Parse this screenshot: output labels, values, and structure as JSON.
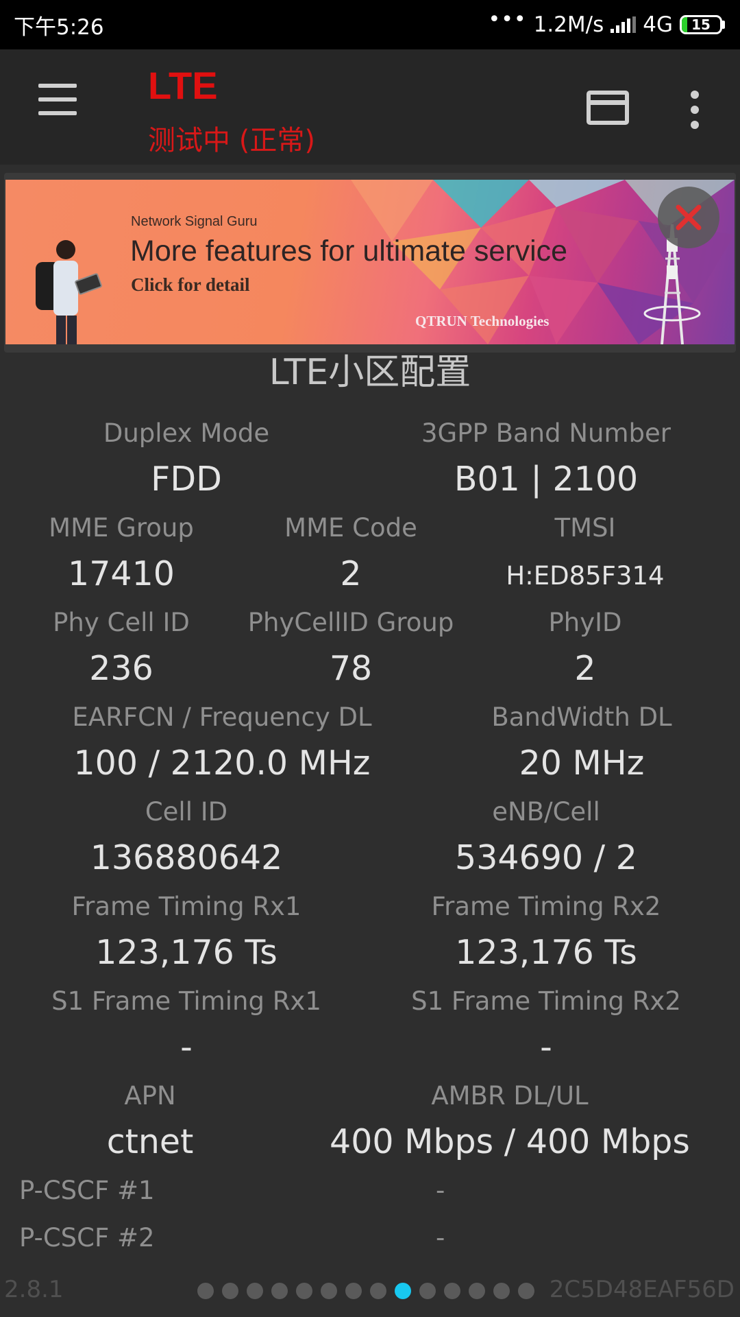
{
  "status_bar": {
    "time": "下午5:26",
    "dots": "•••",
    "speed": "1.2M/s",
    "network": "4G",
    "battery": "15",
    "battery_level": 0.15
  },
  "app_bar": {
    "title": "LTE",
    "subtitle": "测试中 (正常)"
  },
  "ad": {
    "brand": "Network Signal Guru",
    "headline": "More features for ultimate service",
    "subline": "Click for detail",
    "company": "QTRUN Technologies"
  },
  "section_title": "LTE小区配置",
  "fields": {
    "duplex_mode": {
      "label": "Duplex Mode",
      "value": "FDD"
    },
    "band_number": {
      "label": "3GPP Band Number",
      "value": "B01 | 2100"
    },
    "mme_group": {
      "label": "MME Group",
      "value": "17410"
    },
    "mme_code": {
      "label": "MME Code",
      "value": "2"
    },
    "tmsi": {
      "label": "TMSI",
      "value": "H:ED85F314"
    },
    "phy_cell_id": {
      "label": "Phy Cell ID",
      "value": "236"
    },
    "phycellid_group": {
      "label": "PhyCellID Group",
      "value": "78"
    },
    "phyid": {
      "label": "PhyID",
      "value": "2"
    },
    "earfcn": {
      "label": "EARFCN / Frequency DL",
      "value": "100 / 2120.0 MHz"
    },
    "bandwidth_dl": {
      "label": "BandWidth DL",
      "value": "20 MHz"
    },
    "cell_id": {
      "label": "Cell ID",
      "value": "136880642"
    },
    "enb_cell": {
      "label": "eNB/Cell",
      "value": "534690 / 2"
    },
    "frame_timing_rx1": {
      "label": "Frame Timing Rx1",
      "value": "123,176 Ts"
    },
    "frame_timing_rx2": {
      "label": "Frame Timing Rx2",
      "value": "123,176 Ts"
    },
    "s1_frame_timing_rx1": {
      "label": "S1 Frame Timing Rx1",
      "value": "-"
    },
    "s1_frame_timing_rx2": {
      "label": "S1 Frame Timing Rx2",
      "value": "-"
    },
    "apn": {
      "label": "APN",
      "value": "ctnet"
    },
    "ambr": {
      "label": "AMBR DL/UL",
      "value": "400 Mbps / 400 Mbps"
    },
    "pcscf1": {
      "label": "P-CSCF #1",
      "value": "-"
    },
    "pcscf2": {
      "label": "P-CSCF #2",
      "value": "-"
    }
  },
  "footer": {
    "version": "2.8.1",
    "device_id": "2C5D48EAF56D",
    "page_count": 14,
    "active_page": 9
  },
  "colors": {
    "background": "#2e2e2e",
    "title_red": "#e01010",
    "pager_active": "#18c8f0"
  }
}
